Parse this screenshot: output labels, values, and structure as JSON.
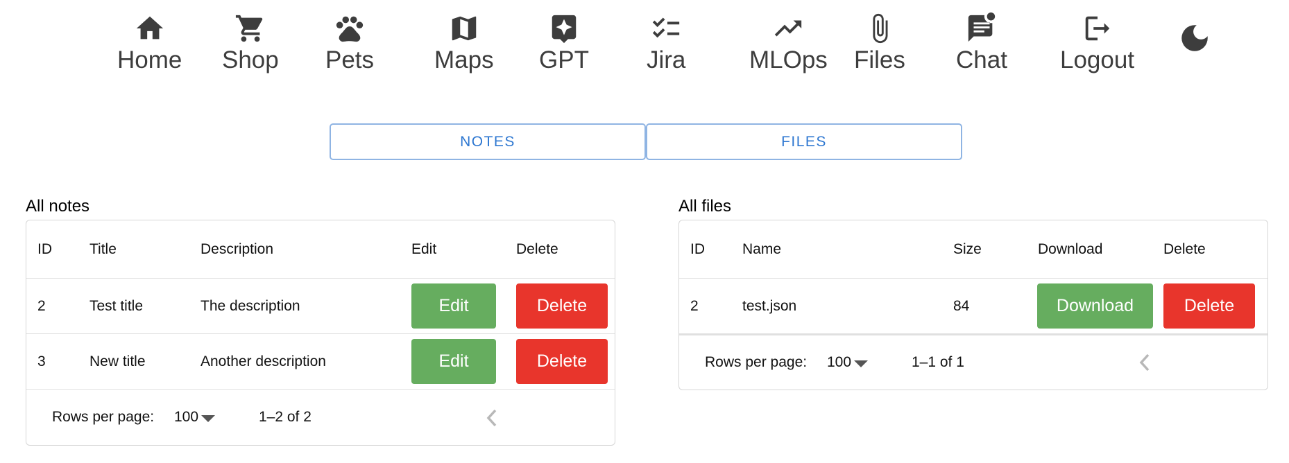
{
  "nav": {
    "items": [
      {
        "label": "Home",
        "icon": "home-icon"
      },
      {
        "label": "Shop",
        "icon": "cart-icon"
      },
      {
        "label": "Pets",
        "icon": "paw-icon"
      },
      {
        "label": "Maps",
        "icon": "map-icon"
      },
      {
        "label": "GPT",
        "icon": "sparkle-chat-icon"
      },
      {
        "label": "Jira",
        "icon": "checklist-icon"
      },
      {
        "label": "MLOps",
        "icon": "trending-up-icon"
      },
      {
        "label": "Files",
        "icon": "paperclip-icon"
      },
      {
        "label": "Chat",
        "icon": "chat-bubble-icon"
      },
      {
        "label": "Logout",
        "icon": "logout-icon"
      }
    ],
    "theme_icon": "moon-icon"
  },
  "tabs": {
    "notes": "NOTES",
    "files": "FILES"
  },
  "notes": {
    "title": "All notes",
    "columns": [
      "ID",
      "Title",
      "Description",
      "Edit",
      "Delete"
    ],
    "rows": [
      {
        "id": "2",
        "title": "Test title",
        "description": "The description",
        "edit": "Edit",
        "delete": "Delete"
      },
      {
        "id": "3",
        "title": "New title",
        "description": "Another description",
        "edit": "Edit",
        "delete": "Delete"
      }
    ],
    "footer": {
      "rows_per_page_label": "Rows per page:",
      "rows_per_page": "100",
      "range": "1–2 of 2"
    }
  },
  "files": {
    "title": "All files",
    "columns": [
      "ID",
      "Name",
      "Size",
      "Download",
      "Delete"
    ],
    "rows": [
      {
        "id": "2",
        "name": "test.json",
        "size": "84",
        "download": "Download",
        "delete": "Delete"
      }
    ],
    "footer": {
      "rows_per_page_label": "Rows per page:",
      "rows_per_page": "100",
      "range": "1–1 of 1"
    }
  },
  "colors": {
    "accent": "#2f78d1",
    "edit": "#66ad5f",
    "delete": "#e8352c",
    "icon": "#3d3d3d"
  }
}
